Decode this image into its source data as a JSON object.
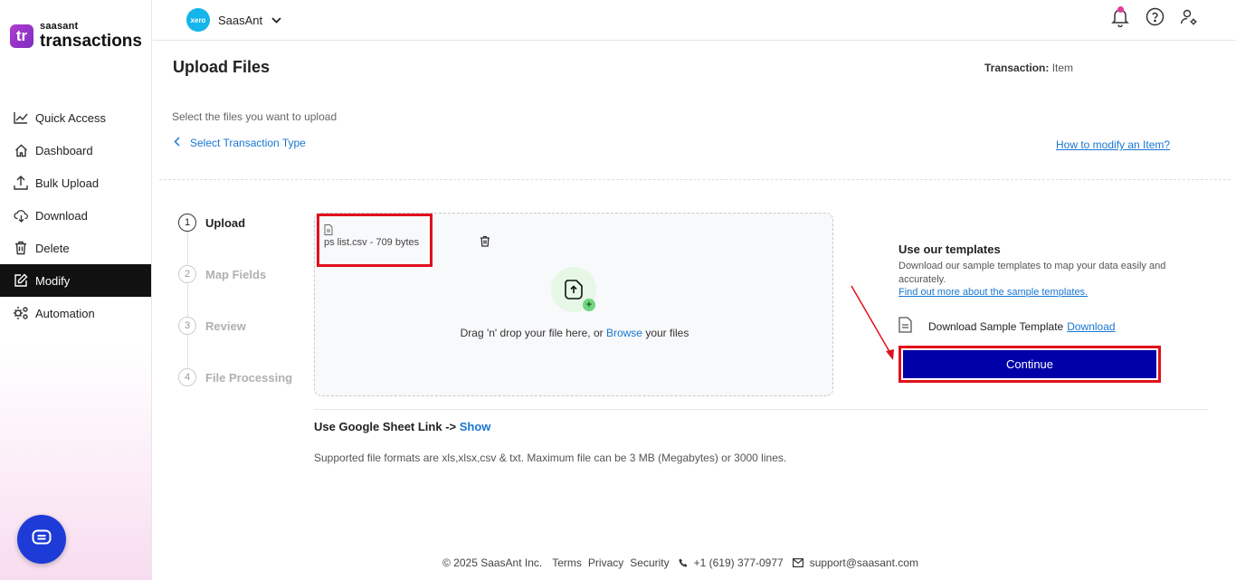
{
  "app": {
    "brand": "saasant",
    "product": "transactions",
    "logo_glyph": "tr"
  },
  "sidebar": {
    "items": [
      {
        "label": "Quick Access",
        "icon": "chart-line-icon"
      },
      {
        "label": "Dashboard",
        "icon": "home-icon"
      },
      {
        "label": "Bulk Upload",
        "icon": "upload-icon"
      },
      {
        "label": "Download",
        "icon": "cloud-download-icon"
      },
      {
        "label": "Delete",
        "icon": "trash-icon"
      },
      {
        "label": "Modify",
        "icon": "edit-icon",
        "active": true
      },
      {
        "label": "Automation",
        "icon": "gears-icon"
      }
    ]
  },
  "topbar": {
    "org_badge": "xero",
    "org_name": "SaasAnt"
  },
  "header": {
    "title": "Upload Files",
    "transaction_label": "Transaction:",
    "transaction_value": "Item",
    "subtitle": "Select the files you want to upload",
    "back_label": "Select Transaction Type",
    "help_link": "How to modify an Item?"
  },
  "stepper": [
    {
      "num": "1",
      "label": "Upload"
    },
    {
      "num": "2",
      "label": "Map Fields"
    },
    {
      "num": "3",
      "label": "Review"
    },
    {
      "num": "4",
      "label": "File Processing"
    }
  ],
  "dropzone": {
    "file_name": "ps list.csv - 709 bytes",
    "text_before": "Drag 'n' drop your file here, or",
    "browse": "Browse",
    "text_after": "your files"
  },
  "templates": {
    "title": "Use our templates",
    "desc": "Download our sample templates to map your data easily and accurately.",
    "link": "Find out more about the sample templates.",
    "download_label": "Download Sample Template",
    "download_link": "Download",
    "continue": "Continue"
  },
  "gsheet": {
    "label": "Use Google Sheet Link ->",
    "show": "Show"
  },
  "formats_note": "Supported file formats are xls,xlsx,csv & txt. Maximum file can be 3 MB (Megabytes) or 3000 lines.",
  "footer": {
    "copyright": "© 2025 SaasAnt Inc.",
    "terms": "Terms",
    "privacy": "Privacy",
    "security": "Security",
    "phone": "+1 (619) 377-0977",
    "email": "support@saasant.com"
  },
  "colors": {
    "accent": "#1976d2",
    "continue_bg": "#0000a8",
    "highlight": "#e0101c",
    "active_nav": "#111111"
  }
}
